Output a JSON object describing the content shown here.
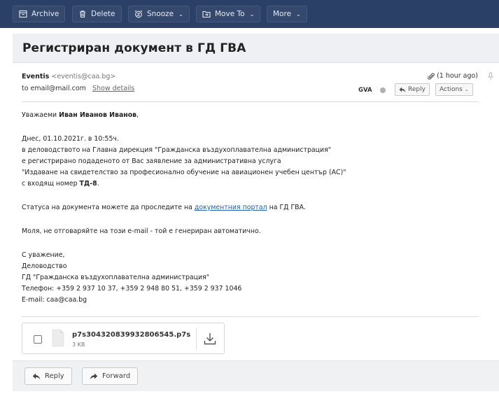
{
  "toolbar": {
    "archive": "Archive",
    "delete": "Delete",
    "snooze": "Snooze",
    "move_to": "Move To",
    "more": "More"
  },
  "subject": "Регистриран документ в ГД ГВА",
  "header": {
    "sender_name": "Eventis",
    "sender_email": "<eventis@caa.bg>",
    "to": "to email@mail.com",
    "show_details": "Show details",
    "time": "(1 hour ago)",
    "tag": "GVA",
    "reply": "Reply",
    "actions": "Actions"
  },
  "body": {
    "greeting_pre": "Уважаеми ",
    "greeting_name": "Иван Иванов Иванов",
    "greeting_post": ",",
    "line1": "Днес, 01.10.2021г. в 10:55ч.",
    "line2": "в деловодството на Главна дирекция \"Гражданска въздухоплавателна администрация\"",
    "line3": "е регистрирано подаденото от Вас заявление за административна услуга",
    "line4": "\"Издаване на свидетелство за професионално обучение на авиационен учебен център (АС)\"",
    "line5_pre": "с входящ номер ",
    "line5_num": "ТД-8",
    "line5_post": ".",
    "status_pre": "Статуса на документа можете да проследите на ",
    "status_link": "документния портал",
    "status_post": " на ГД ГВА.",
    "no_reply": "Моля, не отговаряйте на този e-mail - той е генериран автоматично.",
    "sig1": "С уважение,",
    "sig2": "Деловодство",
    "sig3": "ГД \"Гражданска въздухоплавателна администрация\"",
    "sig4": "Телефон: +359 2 937 10 37, +359 2 948 80 51, +359 2 937 1046",
    "sig5": "E-mail: caa@caa.bg"
  },
  "attachment": {
    "name": "p7s304320839932806545.p7s",
    "size": "3 KB"
  },
  "footer": {
    "reply": "Reply",
    "forward": "Forward"
  }
}
